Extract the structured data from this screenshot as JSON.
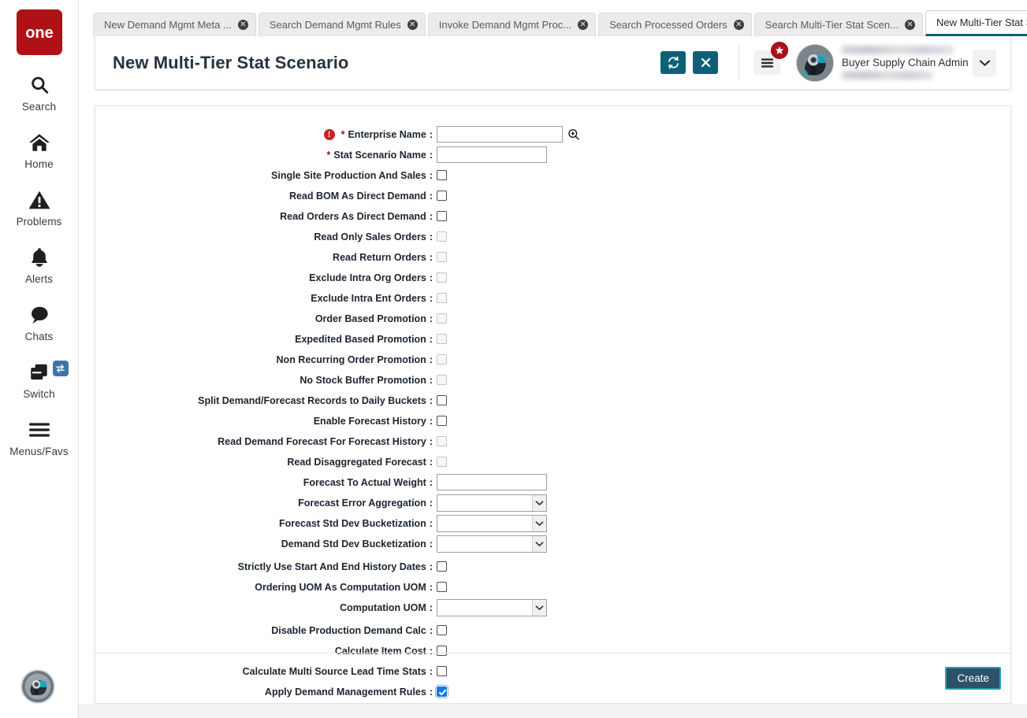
{
  "app": {
    "logo_text": "one",
    "brand_color": "#b01116",
    "accent_teal": "#0d6177"
  },
  "sidebar": {
    "items": [
      {
        "label": "Search",
        "icon": "search-icon"
      },
      {
        "label": "Home",
        "icon": "home-icon"
      },
      {
        "label": "Problems",
        "icon": "warning-triangle-icon"
      },
      {
        "label": "Alerts",
        "icon": "bell-icon"
      },
      {
        "label": "Chats",
        "icon": "chat-bubble-icon"
      },
      {
        "label": "Switch",
        "icon": "switch-windows-icon",
        "badge_icon": "swap-arrows-icon"
      },
      {
        "label": "Menus/Favs",
        "icon": "hamburger-icon"
      }
    ],
    "avatar_name": "user-avatar"
  },
  "tabs": [
    {
      "label": "New Demand Mgmt Meta ...",
      "active": false
    },
    {
      "label": "Search Demand Mgmt Rules",
      "active": false
    },
    {
      "label": "Invoke Demand Mgmt Proc...",
      "active": false
    },
    {
      "label": "Search Processed Orders",
      "active": false
    },
    {
      "label": "Search Multi-Tier Stat Scen...",
      "active": false
    },
    {
      "label": "New Multi-Tier Stat Scenario",
      "active": true
    }
  ],
  "header": {
    "title": "New Multi-Tier Stat Scenario",
    "refresh_icon": "refresh-icon",
    "close_icon": "close-x-icon",
    "menu_icon": "hamburger-menu-icon",
    "menu_badge_icon": "star-icon",
    "user_role": "Buyer Supply Chain Admin",
    "user_caret_icon": "chevron-down-icon"
  },
  "form": {
    "fields": [
      {
        "label": "Enterprise Name",
        "type": "text",
        "required": true,
        "error": true,
        "value": "",
        "width": "wide",
        "lookup_icon": "magnifier-plus-icon"
      },
      {
        "label": "Stat Scenario Name",
        "type": "text",
        "required": true,
        "error": false,
        "value": "",
        "width": "mid"
      },
      {
        "label": "Single Site Production And Sales",
        "type": "checkbox",
        "checked": false,
        "disabled": false
      },
      {
        "label": "Read BOM As Direct Demand",
        "type": "checkbox",
        "checked": false,
        "disabled": false
      },
      {
        "label": "Read Orders As Direct Demand",
        "type": "checkbox",
        "checked": false,
        "disabled": false
      },
      {
        "label": "Read Only Sales Orders",
        "type": "checkbox",
        "checked": false,
        "disabled": true
      },
      {
        "label": "Read Return Orders",
        "type": "checkbox",
        "checked": false,
        "disabled": true
      },
      {
        "label": "Exclude Intra Org Orders",
        "type": "checkbox",
        "checked": false,
        "disabled": true
      },
      {
        "label": "Exclude Intra Ent Orders",
        "type": "checkbox",
        "checked": false,
        "disabled": true
      },
      {
        "label": "Order Based Promotion",
        "type": "checkbox",
        "checked": false,
        "disabled": true
      },
      {
        "label": "Expedited Based Promotion",
        "type": "checkbox",
        "checked": false,
        "disabled": true
      },
      {
        "label": "Non Recurring Order Promotion",
        "type": "checkbox",
        "checked": false,
        "disabled": true
      },
      {
        "label": "No Stock Buffer Promotion",
        "type": "checkbox",
        "checked": false,
        "disabled": true
      },
      {
        "label": "Split Demand/Forecast Records to Daily Buckets",
        "type": "checkbox",
        "checked": false,
        "disabled": false
      },
      {
        "label": "Enable Forecast History",
        "type": "checkbox",
        "checked": false,
        "disabled": false
      },
      {
        "label": "Read Demand Forecast For Forecast History",
        "type": "checkbox",
        "checked": false,
        "disabled": true
      },
      {
        "label": "Read Disaggregated Forecast",
        "type": "checkbox",
        "checked": false,
        "disabled": true
      },
      {
        "label": "Forecast To Actual Weight",
        "type": "text",
        "required": false,
        "error": false,
        "value": "",
        "width": "mid"
      },
      {
        "label": "Forecast Error Aggregation",
        "type": "select",
        "value": "",
        "options": []
      },
      {
        "label": "Forecast Std Dev Bucketization",
        "type": "select",
        "value": "",
        "options": []
      },
      {
        "label": "Demand Std Dev Bucketization",
        "type": "select",
        "value": "",
        "options": []
      },
      {
        "label": "Strictly Use Start And End History Dates",
        "type": "checkbox",
        "checked": false,
        "disabled": false
      },
      {
        "label": "Ordering UOM As Computation UOM",
        "type": "checkbox",
        "checked": false,
        "disabled": false
      },
      {
        "label": "Computation UOM",
        "type": "select",
        "value": "",
        "options": []
      },
      {
        "label": "Disable Production Demand Calc",
        "type": "checkbox",
        "checked": false,
        "disabled": false
      },
      {
        "label": "Calculate Item Cost",
        "type": "checkbox",
        "checked": false,
        "disabled": false
      },
      {
        "label": "Calculate Multi Source Lead Time Stats",
        "type": "checkbox",
        "checked": false,
        "disabled": false
      },
      {
        "label": "Apply Demand Management Rules",
        "type": "checkbox",
        "checked": true,
        "disabled": false
      }
    ]
  },
  "footer": {
    "create_label": "Create"
  }
}
